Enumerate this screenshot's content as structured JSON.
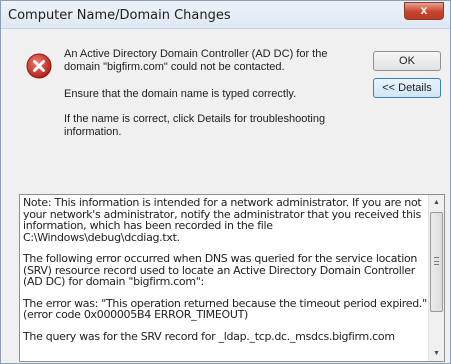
{
  "window": {
    "title": "Computer Name/Domain Changes",
    "close_glyph": "x"
  },
  "icon": "error-icon",
  "messages": {
    "line1": "An Active Directory Domain Controller (AD DC) for the domain \"bigfirm.com\" could not be contacted.",
    "line2": "Ensure that the domain name is typed correctly.",
    "line3": "If the name is correct, click Details for troubleshooting information."
  },
  "buttons": {
    "ok": "OK",
    "details": "<< Details"
  },
  "details": {
    "paragraphs": [
      "Note: This information is intended for a network administrator.  If you are not your network's administrator, notify the administrator that you received this information, which has been recorded in the file C:\\Windows\\debug\\dcdiag.txt.",
      "The following error occurred when DNS was queried for the service location (SRV) resource record used to locate an Active Directory Domain Controller (AD DC) for domain \"bigfirm.com\":",
      "The error was: \"This operation returned because the timeout period expired.\"\n(error code 0x000005B4 ERROR_TIMEOUT)",
      "The query was for the SRV record for _ldap._tcp.dc._msdcs.bigfirm.com"
    ],
    "scroll_up_glyph": "▲",
    "scroll_down_glyph": "▼"
  },
  "colors": {
    "error_red": "#c9302c",
    "close_red": "#c7442d"
  }
}
